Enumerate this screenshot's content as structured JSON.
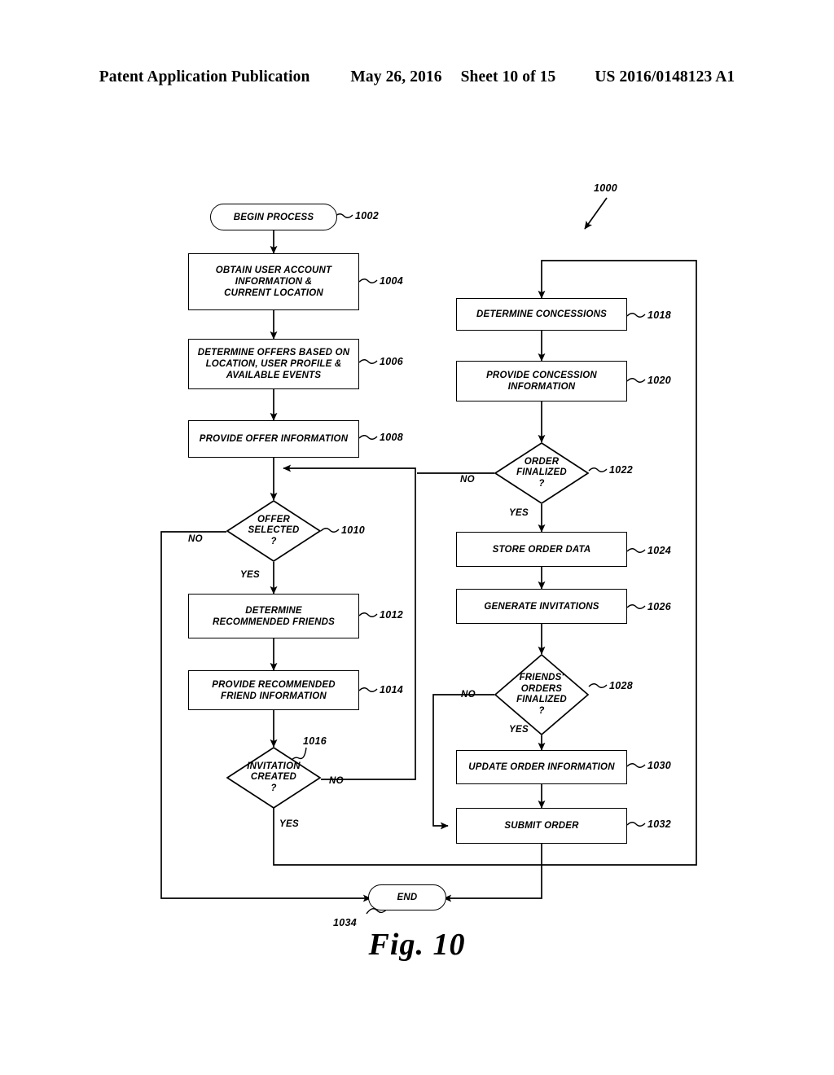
{
  "header": {
    "publication": "Patent Application Publication",
    "date": "May 26, 2016",
    "sheet": "Sheet 10 of 15",
    "patent_number": "US 2016/0148123 A1"
  },
  "figure": {
    "caption": "Fig. 10",
    "diagram_ref": "1000"
  },
  "nodes": [
    {
      "ref": "1002",
      "label": "BEGIN PROCESS",
      "shape": "terminator"
    },
    {
      "ref": "1004",
      "label": "OBTAIN USER ACCOUNT INFORMATION & CURRENT LOCATION",
      "shape": "process"
    },
    {
      "ref": "1006",
      "label": "DETERMINE OFFERS BASED ON LOCATION, USER PROFILE & AVAILABLE EVENTS",
      "shape": "process"
    },
    {
      "ref": "1008",
      "label": "PROVIDE OFFER INFORMATION",
      "shape": "process"
    },
    {
      "ref": "1010",
      "label": "OFFER SELECTED ?",
      "shape": "decision"
    },
    {
      "ref": "1012",
      "label": "DETERMINE RECOMMENDED FRIENDS",
      "shape": "process"
    },
    {
      "ref": "1014",
      "label": "PROVIDE RECOMMENDED FRIEND INFORMATION",
      "shape": "process"
    },
    {
      "ref": "1016",
      "label": "INVITATION CREATED ?",
      "shape": "decision"
    },
    {
      "ref": "1018",
      "label": "DETERMINE CONCESSIONS",
      "shape": "process"
    },
    {
      "ref": "1020",
      "label": "PROVIDE CONCESSION INFORMATION",
      "shape": "process"
    },
    {
      "ref": "1022",
      "label": "ORDER FINALIZED ?",
      "shape": "decision"
    },
    {
      "ref": "1024",
      "label": "STORE ORDER DATA",
      "shape": "process"
    },
    {
      "ref": "1026",
      "label": "GENERATE INVITATIONS",
      "shape": "process"
    },
    {
      "ref": "1028",
      "label": "FRIENDS' ORDERS FINALIZED ?",
      "shape": "decision"
    },
    {
      "ref": "1030",
      "label": "UPDATE ORDER INFORMATION",
      "shape": "process"
    },
    {
      "ref": "1032",
      "label": "SUBMIT ORDER",
      "shape": "process"
    },
    {
      "ref": "1034",
      "label": "END",
      "shape": "terminator"
    }
  ],
  "node_text": {
    "n1002": "BEGIN PROCESS",
    "n1004_l1": "OBTAIN USER ACCOUNT",
    "n1004_l2": "INFORMATION &",
    "n1004_l3": "CURRENT LOCATION",
    "n1006_l1": "DETERMINE OFFERS BASED ON",
    "n1006_l2": "LOCATION, USER PROFILE &",
    "n1006_l3": "AVAILABLE EVENTS",
    "n1008": "PROVIDE OFFER INFORMATION",
    "n1010_l1": "OFFER",
    "n1010_l2": "SELECTED",
    "n1010_l3": "?",
    "n1012_l1": "DETERMINE",
    "n1012_l2": "RECOMMENDED FRIENDS",
    "n1014_l1": "PROVIDE RECOMMENDED",
    "n1014_l2": "FRIEND INFORMATION",
    "n1016_l1": "INVITATION",
    "n1016_l2": "CREATED",
    "n1016_l3": "?",
    "n1018": "DETERMINE CONCESSIONS",
    "n1020_l1": "PROVIDE CONCESSION",
    "n1020_l2": "INFORMATION",
    "n1022_l1": "ORDER",
    "n1022_l2": "FINALIZED",
    "n1022_l3": "?",
    "n1024": "STORE ORDER DATA",
    "n1026": "GENERATE INVITATIONS",
    "n1028_l1": "FRIENDS'",
    "n1028_l2": "ORDERS",
    "n1028_l3": "FINALIZED",
    "n1028_l4": "?",
    "n1030": "UPDATE ORDER INFORMATION",
    "n1032": "SUBMIT ORDER",
    "n1034": "END"
  },
  "refs": {
    "r1000": "1000",
    "r1002": "1002",
    "r1004": "1004",
    "r1006": "1006",
    "r1008": "1008",
    "r1010": "1010",
    "r1012": "1012",
    "r1014": "1014",
    "r1016": "1016",
    "r1018": "1018",
    "r1020": "1020",
    "r1022": "1022",
    "r1024": "1024",
    "r1026": "1026",
    "r1028": "1028",
    "r1030": "1030",
    "r1032": "1032",
    "r1034": "1034"
  },
  "branches": {
    "b1010_no": "NO",
    "b1010_yes": "YES",
    "b1016_no": "NO",
    "b1016_yes": "YES",
    "b1022_no": "NO",
    "b1022_yes": "YES",
    "b1028_no": "NO",
    "b1028_yes": "YES"
  },
  "colors": {
    "ink": "#000000",
    "paper": "#ffffff"
  }
}
